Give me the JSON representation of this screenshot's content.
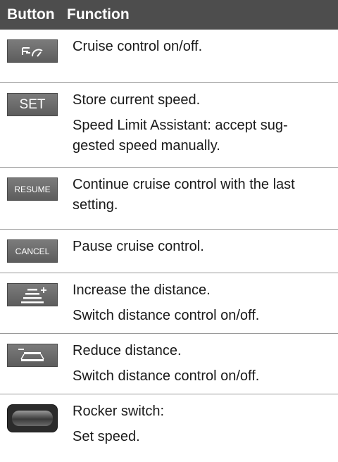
{
  "header": {
    "button": "Button",
    "function": "Function"
  },
  "rows": [
    {
      "icon": "cruise-control-icon",
      "label": "",
      "texts": [
        "Cruise control on/off."
      ]
    },
    {
      "icon": "set-button",
      "label": "SET",
      "texts": [
        "Store current speed.",
        "Speed Limit Assistant: accept sug-gested speed manually."
      ]
    },
    {
      "icon": "resume-button",
      "label": "RESUME",
      "texts": [
        "Continue cruise control with the last setting."
      ]
    },
    {
      "icon": "cancel-button",
      "label": "CANCEL",
      "texts": [
        "Pause cruise control."
      ]
    },
    {
      "icon": "increase-distance-icon",
      "label": "",
      "texts": [
        "Increase the distance.",
        "Switch distance control on/off."
      ]
    },
    {
      "icon": "reduce-distance-icon",
      "label": "",
      "texts": [
        "Reduce distance.",
        "Switch distance control on/off."
      ]
    },
    {
      "icon": "rocker-switch-icon",
      "label": "",
      "texts": [
        "Rocker switch:",
        "Set speed."
      ]
    }
  ]
}
